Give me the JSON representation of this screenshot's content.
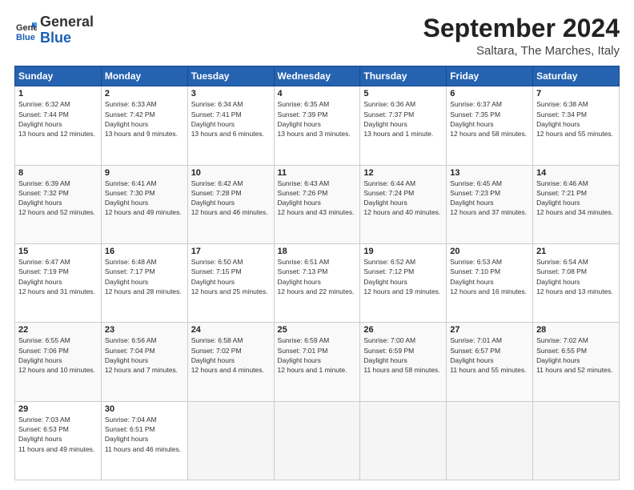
{
  "logo": {
    "line1": "General",
    "line2": "Blue"
  },
  "title": "September 2024",
  "location": "Saltara, The Marches, Italy",
  "days_of_week": [
    "Sunday",
    "Monday",
    "Tuesday",
    "Wednesday",
    "Thursday",
    "Friday",
    "Saturday"
  ],
  "weeks": [
    [
      {
        "day": "1",
        "sunrise": "6:32 AM",
        "sunset": "7:44 PM",
        "daylight": "13 hours and 12 minutes."
      },
      {
        "day": "2",
        "sunrise": "6:33 AM",
        "sunset": "7:42 PM",
        "daylight": "13 hours and 9 minutes."
      },
      {
        "day": "3",
        "sunrise": "6:34 AM",
        "sunset": "7:41 PM",
        "daylight": "13 hours and 6 minutes."
      },
      {
        "day": "4",
        "sunrise": "6:35 AM",
        "sunset": "7:39 PM",
        "daylight": "13 hours and 3 minutes."
      },
      {
        "day": "5",
        "sunrise": "6:36 AM",
        "sunset": "7:37 PM",
        "daylight": "13 hours and 1 minute."
      },
      {
        "day": "6",
        "sunrise": "6:37 AM",
        "sunset": "7:35 PM",
        "daylight": "12 hours and 58 minutes."
      },
      {
        "day": "7",
        "sunrise": "6:38 AM",
        "sunset": "7:34 PM",
        "daylight": "12 hours and 55 minutes."
      }
    ],
    [
      {
        "day": "8",
        "sunrise": "6:39 AM",
        "sunset": "7:32 PM",
        "daylight": "12 hours and 52 minutes."
      },
      {
        "day": "9",
        "sunrise": "6:41 AM",
        "sunset": "7:30 PM",
        "daylight": "12 hours and 49 minutes."
      },
      {
        "day": "10",
        "sunrise": "6:42 AM",
        "sunset": "7:28 PM",
        "daylight": "12 hours and 46 minutes."
      },
      {
        "day": "11",
        "sunrise": "6:43 AM",
        "sunset": "7:26 PM",
        "daylight": "12 hours and 43 minutes."
      },
      {
        "day": "12",
        "sunrise": "6:44 AM",
        "sunset": "7:24 PM",
        "daylight": "12 hours and 40 minutes."
      },
      {
        "day": "13",
        "sunrise": "6:45 AM",
        "sunset": "7:23 PM",
        "daylight": "12 hours and 37 minutes."
      },
      {
        "day": "14",
        "sunrise": "6:46 AM",
        "sunset": "7:21 PM",
        "daylight": "12 hours and 34 minutes."
      }
    ],
    [
      {
        "day": "15",
        "sunrise": "6:47 AM",
        "sunset": "7:19 PM",
        "daylight": "12 hours and 31 minutes."
      },
      {
        "day": "16",
        "sunrise": "6:48 AM",
        "sunset": "7:17 PM",
        "daylight": "12 hours and 28 minutes."
      },
      {
        "day": "17",
        "sunrise": "6:50 AM",
        "sunset": "7:15 PM",
        "daylight": "12 hours and 25 minutes."
      },
      {
        "day": "18",
        "sunrise": "6:51 AM",
        "sunset": "7:13 PM",
        "daylight": "12 hours and 22 minutes."
      },
      {
        "day": "19",
        "sunrise": "6:52 AM",
        "sunset": "7:12 PM",
        "daylight": "12 hours and 19 minutes."
      },
      {
        "day": "20",
        "sunrise": "6:53 AM",
        "sunset": "7:10 PM",
        "daylight": "12 hours and 16 minutes."
      },
      {
        "day": "21",
        "sunrise": "6:54 AM",
        "sunset": "7:08 PM",
        "daylight": "12 hours and 13 minutes."
      }
    ],
    [
      {
        "day": "22",
        "sunrise": "6:55 AM",
        "sunset": "7:06 PM",
        "daylight": "12 hours and 10 minutes."
      },
      {
        "day": "23",
        "sunrise": "6:56 AM",
        "sunset": "7:04 PM",
        "daylight": "12 hours and 7 minutes."
      },
      {
        "day": "24",
        "sunrise": "6:58 AM",
        "sunset": "7:02 PM",
        "daylight": "12 hours and 4 minutes."
      },
      {
        "day": "25",
        "sunrise": "6:59 AM",
        "sunset": "7:01 PM",
        "daylight": "12 hours and 1 minute."
      },
      {
        "day": "26",
        "sunrise": "7:00 AM",
        "sunset": "6:59 PM",
        "daylight": "11 hours and 58 minutes."
      },
      {
        "day": "27",
        "sunrise": "7:01 AM",
        "sunset": "6:57 PM",
        "daylight": "11 hours and 55 minutes."
      },
      {
        "day": "28",
        "sunrise": "7:02 AM",
        "sunset": "6:55 PM",
        "daylight": "11 hours and 52 minutes."
      }
    ],
    [
      {
        "day": "29",
        "sunrise": "7:03 AM",
        "sunset": "6:53 PM",
        "daylight": "11 hours and 49 minutes."
      },
      {
        "day": "30",
        "sunrise": "7:04 AM",
        "sunset": "6:51 PM",
        "daylight": "11 hours and 46 minutes."
      },
      null,
      null,
      null,
      null,
      null
    ]
  ]
}
